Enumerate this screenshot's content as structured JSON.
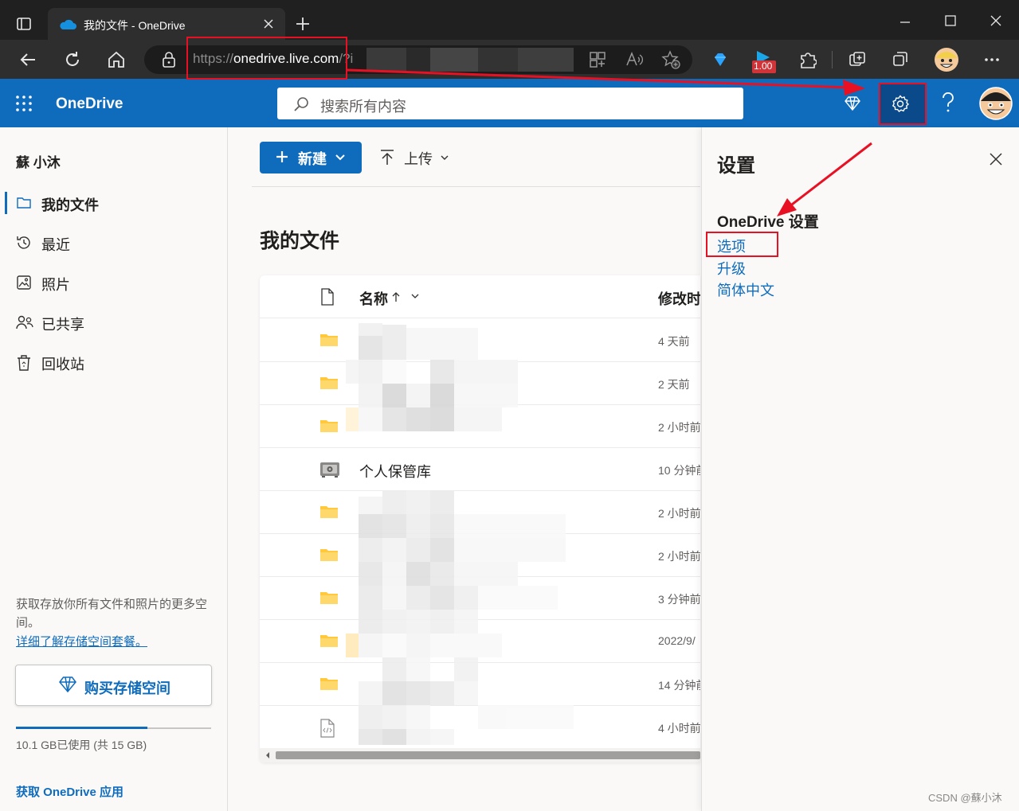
{
  "browser": {
    "tab_title": "我的文件 - OneDrive",
    "url_scheme": "https://",
    "url_host": "onedrive.live.com",
    "url_rest": "/?i",
    "badge_value": "1.00"
  },
  "header": {
    "brand": "OneDrive",
    "search_placeholder": "搜索所有内容"
  },
  "sidebar": {
    "user_name": "蘇 小沐",
    "items": [
      {
        "label": "我的文件",
        "icon": "folder-icon",
        "active": true
      },
      {
        "label": "最近",
        "icon": "clock-icon",
        "active": false
      },
      {
        "label": "照片",
        "icon": "photo-icon",
        "active": false
      },
      {
        "label": "已共享",
        "icon": "people-icon",
        "active": false
      },
      {
        "label": "回收站",
        "icon": "recycle-bin-icon",
        "active": false
      }
    ],
    "promo_text": "获取存放你所有文件和照片的更多空间。",
    "promo_link": "详细了解存储空间套餐。",
    "buy_button": "购买存储空间",
    "storage_used_fraction": 0.673,
    "storage_text": "10.1 GB已使用 (共 15 GB)",
    "get_app": "获取 OneDrive 应用"
  },
  "main": {
    "new_button": "新建",
    "upload_button": "上传",
    "page_title": "我的文件",
    "columns": {
      "name": "名称",
      "modified": "修改时"
    },
    "rows": [
      {
        "type": "folder",
        "name": "",
        "modified": "4 天前"
      },
      {
        "type": "folder",
        "name": "",
        "modified": "2 天前"
      },
      {
        "type": "folder",
        "name": "",
        "modified": "2 小时前"
      },
      {
        "type": "vault",
        "name": "个人保管库",
        "modified": "10 分钟前"
      },
      {
        "type": "folder",
        "name": "",
        "modified": "2 小时前"
      },
      {
        "type": "folder",
        "name": "",
        "modified": "2 小时前"
      },
      {
        "type": "folder",
        "name": "",
        "modified": "3 分钟前"
      },
      {
        "type": "folder",
        "name": "",
        "modified": "2022/9/"
      },
      {
        "type": "folder",
        "name": "",
        "modified": "14 分钟前"
      },
      {
        "type": "code-file",
        "name": "",
        "modified": "4 小时前"
      }
    ]
  },
  "settings": {
    "title": "设置",
    "section": "OneDrive 设置",
    "links": [
      "选项",
      "升级",
      "简体中文"
    ]
  },
  "watermark": "CSDN @蘇小沐",
  "colors": {
    "brand_blue": "#0f6cbd",
    "annotation_red": "#e81123",
    "folder_yellow": "#ffc83d"
  }
}
